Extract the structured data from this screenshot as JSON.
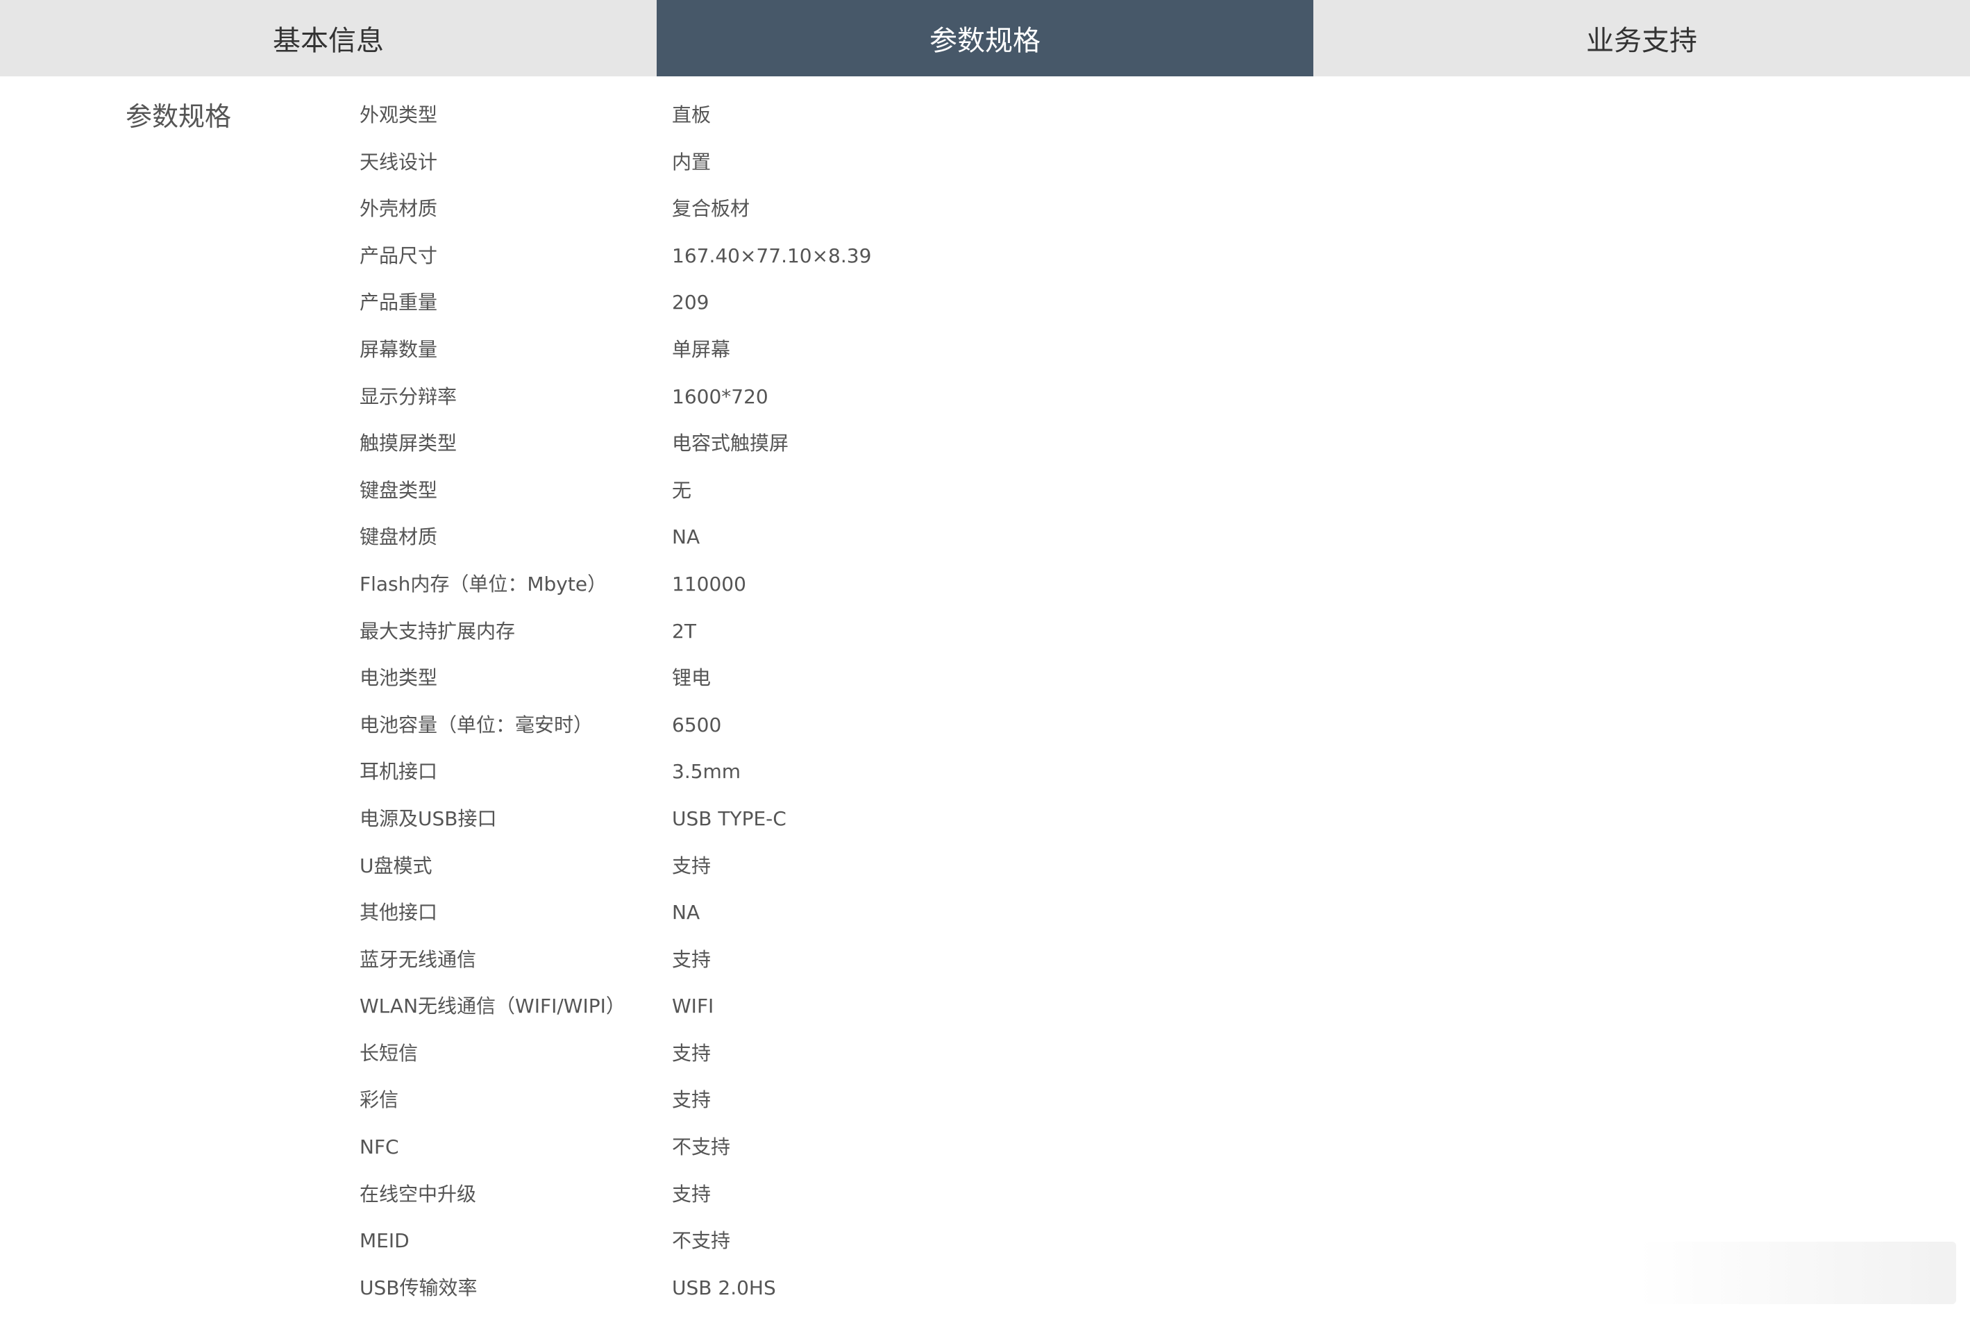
{
  "tabs": [
    {
      "label": "基本信息",
      "active": false
    },
    {
      "label": "参数规格",
      "active": true
    },
    {
      "label": "业务支持",
      "active": false
    }
  ],
  "colors": {
    "tab_bg": "#e6e6e6",
    "tab_active_bg": "#475869",
    "tab_active_text": "#ffffff",
    "text": "#555555"
  },
  "section": {
    "title": "参数规格"
  },
  "specs": [
    {
      "label": "外观类型",
      "value": "直板"
    },
    {
      "label": "天线设计",
      "value": "内置"
    },
    {
      "label": "外壳材质",
      "value": "复合板材"
    },
    {
      "label": "产品尺寸",
      "value": "167.40×77.10×8.39"
    },
    {
      "label": "产品重量",
      "value": "209"
    },
    {
      "label": "屏幕数量",
      "value": "单屏幕"
    },
    {
      "label": "显示分辩率",
      "value": "1600*720"
    },
    {
      "label": "触摸屏类型",
      "value": "电容式触摸屏"
    },
    {
      "label": "键盘类型",
      "value": "无"
    },
    {
      "label": "键盘材质",
      "value": "NA"
    },
    {
      "label": "Flash内存（单位：Mbyte）",
      "value": "110000"
    },
    {
      "label": "最大支持扩展内存",
      "value": "2T"
    },
    {
      "label": "电池类型",
      "value": "锂电"
    },
    {
      "label": "电池容量（单位：毫安时）",
      "value": "6500"
    },
    {
      "label": "耳机接口",
      "value": "3.5mm"
    },
    {
      "label": "电源及USB接口",
      "value": "USB TYPE-C"
    },
    {
      "label": "U盘模式",
      "value": "支持"
    },
    {
      "label": "其他接口",
      "value": "NA"
    },
    {
      "label": "蓝牙无线通信",
      "value": "支持"
    },
    {
      "label": "WLAN无线通信（WIFI/WIPI）",
      "value": "WIFI"
    },
    {
      "label": "长短信",
      "value": "支持"
    },
    {
      "label": "彩信",
      "value": "支持"
    },
    {
      "label": "NFC",
      "value": "不支持"
    },
    {
      "label": "在线空中升级",
      "value": "支持"
    },
    {
      "label": "MEID",
      "value": "不支持"
    },
    {
      "label": "USB传输效率",
      "value": "USB 2.0HS"
    }
  ]
}
